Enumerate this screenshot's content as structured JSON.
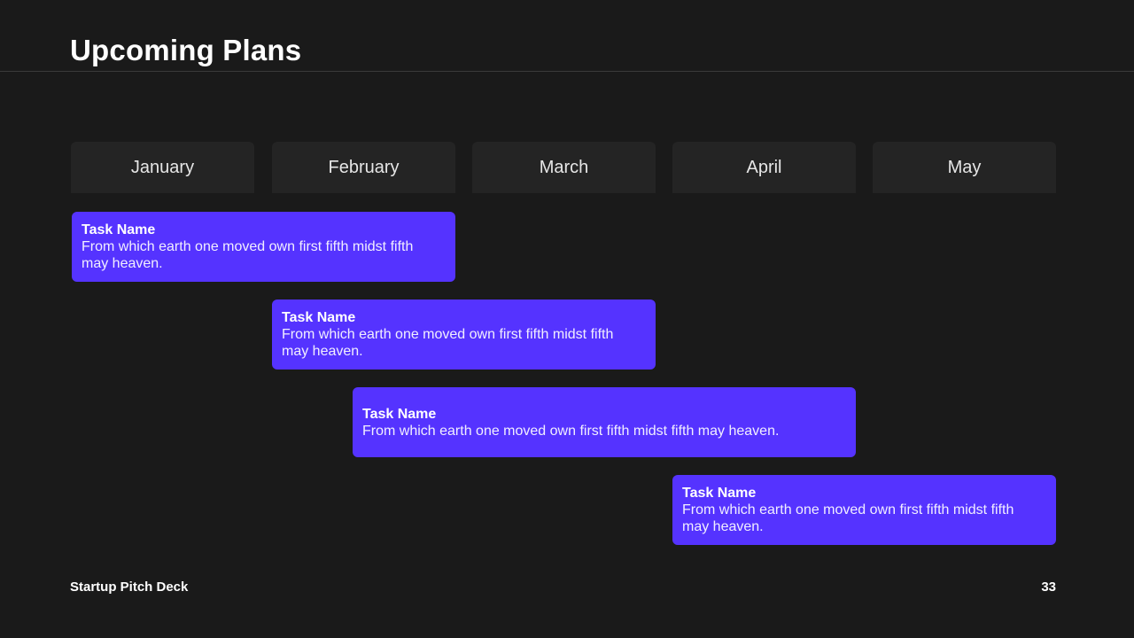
{
  "slide": {
    "title": "Upcoming Plans",
    "footer": "Startup Pitch Deck",
    "page_number": "33"
  },
  "months": [
    "January",
    "February",
    "March",
    "April",
    "May"
  ],
  "tasks": [
    {
      "name": "Task Name",
      "description": "From which earth one moved own first fifth midst fifth may heaven."
    },
    {
      "name": "Task Name",
      "description": "From which earth one moved own first fifth midst fifth may heaven."
    },
    {
      "name": "Task Name",
      "description": "From which earth one moved own first fifth midst fifth may heaven."
    },
    {
      "name": "Task Name",
      "description": "From which earth one moved own first fifth midst fifth may heaven."
    }
  ],
  "colors": {
    "background": "#1a1a1a",
    "month_header": "#242424",
    "task_bar": "#5533ff"
  }
}
